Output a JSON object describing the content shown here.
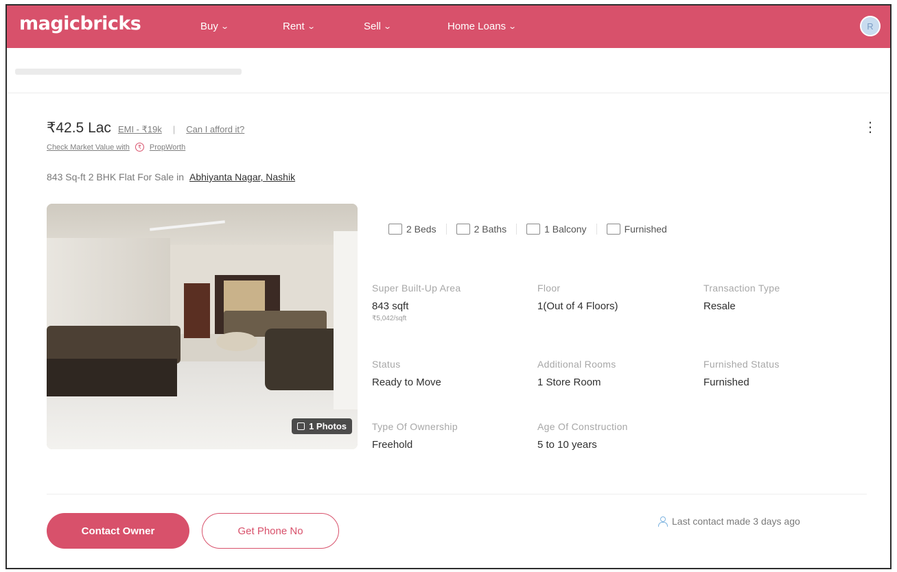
{
  "header": {
    "logo": "magicbricks",
    "nav": [
      "Buy",
      "Rent",
      "Sell",
      "Home Loans"
    ],
    "avatar_initial": "R",
    "brand_color": "#d8516b"
  },
  "listing": {
    "price": "₹42.5 Lac",
    "emi": "EMI - ₹19k",
    "afford": "Can I afford it?",
    "market_value": "Check Market Value with",
    "propworth": "PropWorth",
    "title_prefix": "843 Sq-ft 2 BHK Flat For Sale in",
    "location": "Abhiyanta Nagar, Nashik",
    "photo_count": "1 Photos",
    "amenities": [
      "2 Beds",
      "2 Baths",
      "1 Balcony",
      "Furnished"
    ],
    "details": {
      "super_area": {
        "label": "Super Built-Up Area",
        "value": "843 sqft",
        "sub": "₹5,042/sqft"
      },
      "floor": {
        "label": "Floor",
        "value": "1(Out of 4 Floors)"
      },
      "transaction": {
        "label": "Transaction Type",
        "value": "Resale"
      },
      "status": {
        "label": "Status",
        "value": "Ready to Move"
      },
      "rooms": {
        "label": "Additional Rooms",
        "value": "1 Store Room"
      },
      "furnished": {
        "label": "Furnished Status",
        "value": "Furnished"
      },
      "ownership": {
        "label": "Type Of Ownership",
        "value": "Freehold"
      },
      "age": {
        "label": "Age Of Construction",
        "value": "5 to 10 years"
      }
    },
    "contact_button": "Contact Owner",
    "phone_button": "Get Phone No",
    "last_contact": "Last contact made 3 days ago",
    "menu_glyph": "⋮"
  }
}
